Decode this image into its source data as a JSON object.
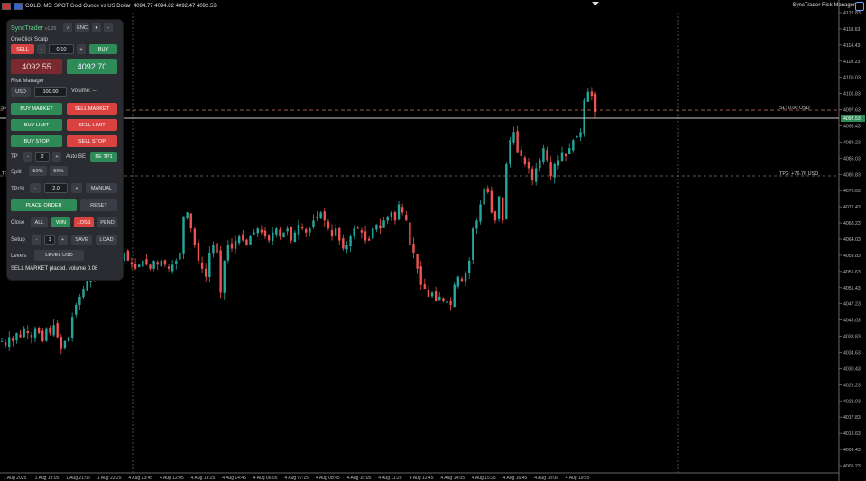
{
  "topbar": {
    "symbol": "GOLD, M5: SPOT Gold Ounce vs US Dollar",
    "ohlc": "4094.77 4094.82 4092.47 4092.53",
    "right_title": "SyncTrader Risk Manager"
  },
  "price_axis": {
    "labels": [
      "4122.83",
      "4118.63",
      "4114.43",
      "4110.23",
      "4106.03",
      "4101.83",
      "4097.63",
      "4093.43",
      "4089.23",
      "4085.03",
      "4080.83",
      "4076.63",
      "4072.43",
      "4068.23",
      "4064.03",
      "4059.83",
      "4055.63",
      "4051.43",
      "4047.23",
      "4043.03",
      "4038.83",
      "4034.63",
      "4030.43",
      "4026.23",
      "4022.03",
      "4017.83",
      "4013.63",
      "4009.43",
      "4005.23"
    ],
    "current_price": "4092.53"
  },
  "time_axis": {
    "labels": [
      "1 Aug 2025",
      "1 Aug 19:05",
      "1 Aug 21:05",
      "1 Aug 22:25",
      "4 Aug 23:45",
      "4 Aug 12:05",
      "4 Aug 13:25",
      "4 Aug 14:45",
      "4 Aug 06:05",
      "4 Aug 07:25",
      "4 Aug 08:45",
      "4 Aug 10:05",
      "4 Aug 11:25",
      "4 Aug 12:45",
      "4 Aug 14:05",
      "4 Aug 15:25",
      "4 Aug 16:45",
      "4 Aug 18:05",
      "4 Aug 19:25"
    ]
  },
  "chart_labels": {
    "sl": "SL: 0.00 USD",
    "tp2": "TP2: +76.76 USD",
    "left_sell": "SELL",
    "left_tp": "TP"
  },
  "panel": {
    "title": "SyncTrader",
    "version": "v1.20",
    "enc": "ENC",
    "minimize": "-",
    "oneclick": "OneClick Scalp",
    "sell": "SELL",
    "minus": "-",
    "lot": "0.10",
    "plus": "+",
    "buy": "BUY",
    "bid": "4092.55",
    "ask": "4092.70",
    "risk_manager": "Risk Manager",
    "currency": "USD",
    "risk_value": "100.00",
    "volume": "Volume: ---",
    "buy_market": "BUY MARKET",
    "sell_market": "SELL MARKET",
    "buy_limit": "BUY LIMIT",
    "sell_limit": "SELL LIMIT",
    "buy_stop": "BUY STOP",
    "sell_stop": "SELL STOP",
    "tp_label": "TP",
    "tp_value": "2",
    "auto_be": "Auto BE",
    "be_tp1": "BE TP1",
    "split_label": "Split",
    "split1": "50%",
    "split2": "50%",
    "tpsl_label": "TP/SL",
    "tpsl_value": "2.0",
    "manual": "MANUAL",
    "place_order": "PLACE ORDER",
    "reset": "RESET",
    "close_label": "Close",
    "close_all": "ALL",
    "close_win": "WIN",
    "close_loss": "LOSS",
    "close_pend": "PEND",
    "setup_label": "Setup",
    "setup_value": "1",
    "save": "SAVE",
    "load": "LOAD",
    "levels_label": "Levels",
    "level_usd": "LEVEL USD",
    "status": "SELL MARKET placed. volume 0.08"
  },
  "colors": {
    "bull": "#26a69a",
    "bear": "#ef5350",
    "sl_line": "#c97a5a",
    "tp_line": "#7a7a7a",
    "bid_line": "#c8c8c8"
  },
  "chart_data": {
    "type": "candlestick",
    "ylim": [
      4005.23,
      4122.83
    ],
    "series": [
      {
        "values": [
          4038,
          4037,
          4039,
          4038,
          4040,
          4039,
          4041,
          4040,
          4039,
          4041,
          4040,
          4038,
          4041,
          4040,
          4042,
          4039,
          4036,
          4038,
          4039,
          4044,
          4047,
          4049,
          4051,
          4053,
          4055,
          4054,
          4056,
          4058,
          4060,
          4059,
          4057,
          4055,
          4058,
          4060,
          4058,
          4057,
          4056,
          4057,
          4058,
          4057,
          4056,
          4058,
          4057,
          4058,
          4057,
          4056,
          4057,
          4058,
          4060,
          4069,
          4070,
          4066,
          4062,
          4058,
          4056,
          4054,
          4060,
          4062,
          4060,
          4050,
          4058,
          4062,
          4061,
          4063,
          4064,
          4063,
          4062,
          4064,
          4065,
          4066,
          4065,
          4064,
          4063,
          4065,
          4066,
          4064,
          4065,
          4066,
          4063,
          4065,
          4067,
          4066,
          4065,
          4066,
          4068,
          4069,
          4070,
          4068,
          4066,
          4064,
          4066,
          4063,
          4061,
          4062,
          4064,
          4066,
          4066,
          4065,
          4063,
          4063,
          4066,
          4067,
          4066,
          4068,
          4069,
          4070,
          4068,
          4072,
          4070,
          4068,
          4062,
          4060,
          4056,
          4052,
          4051,
          4049,
          4050,
          4048,
          4049,
          4048,
          4048,
          4047,
          4052,
          4054,
          4053,
          4055,
          4058,
          4066,
          4068,
          4072,
          4076,
          4075,
          4070,
          4068,
          4074,
          4068,
          4082,
          4088,
          4090,
          4085,
          4084,
          4082,
          4081,
          4078,
          4081,
          4083,
          4086,
          4083,
          4079,
          4082,
          4083,
          4085,
          4084,
          4086,
          4088,
          4089,
          4090,
          4098,
          4100,
          4099,
          4095
        ]
      }
    ]
  }
}
